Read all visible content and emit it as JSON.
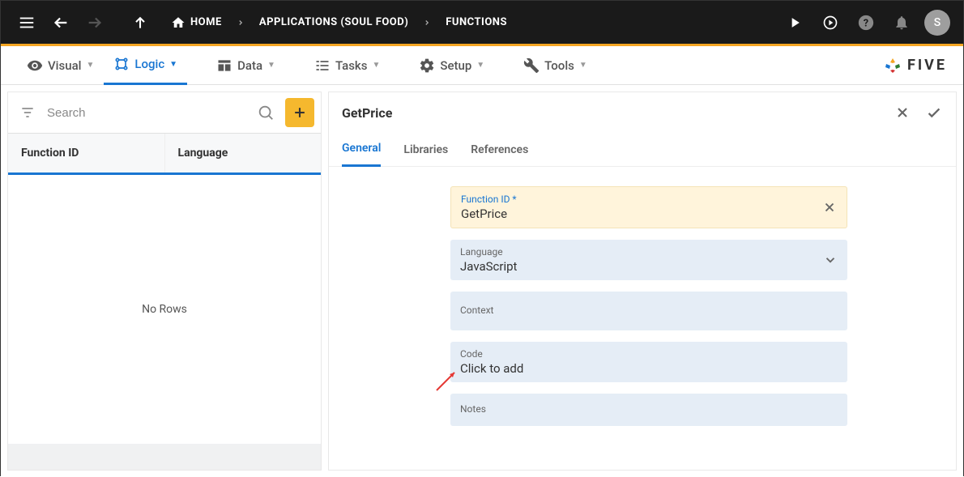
{
  "topbar": {
    "breadcrumbs": [
      {
        "label": "HOME"
      },
      {
        "label": "APPLICATIONS (SOUL FOOD)"
      },
      {
        "label": "FUNCTIONS"
      }
    ],
    "avatar": "S"
  },
  "nav": {
    "items": [
      {
        "label": "Visual"
      },
      {
        "label": "Logic"
      },
      {
        "label": "Data"
      },
      {
        "label": "Tasks"
      },
      {
        "label": "Setup"
      },
      {
        "label": "Tools"
      }
    ],
    "logo": "FIVE"
  },
  "left": {
    "search_placeholder": "Search",
    "columns": [
      "Function ID",
      "Language"
    ],
    "empty_text": "No Rows"
  },
  "right": {
    "title": "GetPrice",
    "tabs": [
      "General",
      "Libraries",
      "References"
    ],
    "fields": {
      "function_id": {
        "label": "Function ID *",
        "value": "GetPrice"
      },
      "language": {
        "label": "Language",
        "value": "JavaScript"
      },
      "context": {
        "label": "Context",
        "value": ""
      },
      "code": {
        "label": "Code",
        "value": "Click to add"
      },
      "notes": {
        "label": "Notes",
        "value": ""
      }
    }
  }
}
